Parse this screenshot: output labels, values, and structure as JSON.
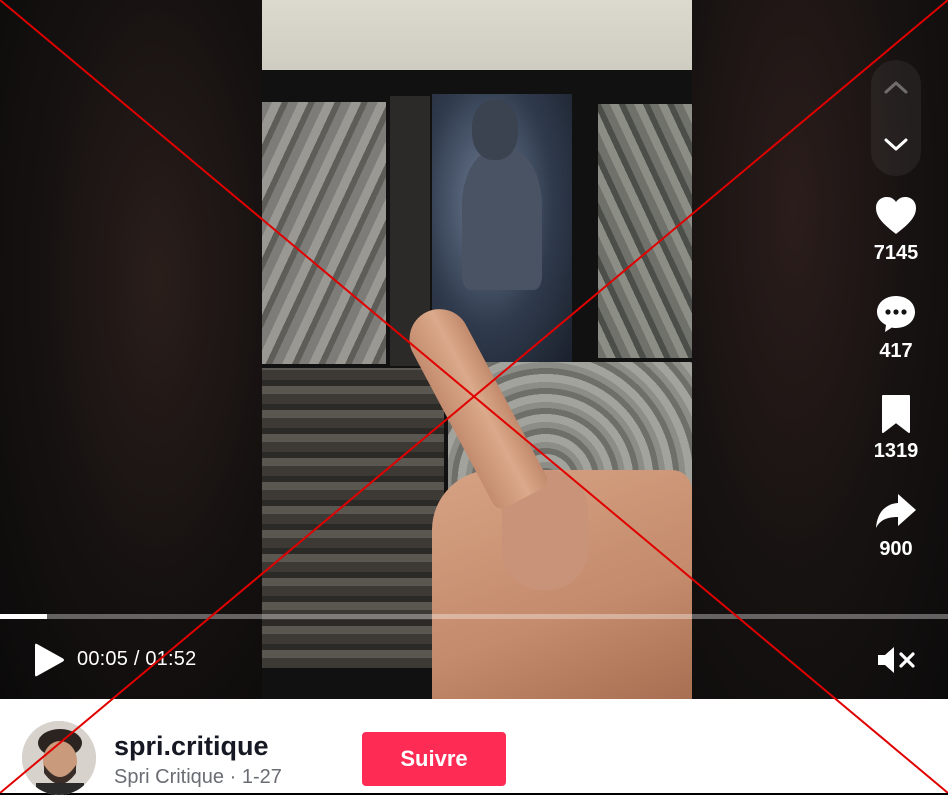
{
  "player": {
    "current_time": "00:05",
    "time_separator": " / ",
    "duration": "01:52",
    "progress_fraction": 0.05
  },
  "actions": {
    "likes": "7145",
    "comments": "417",
    "saves": "1319",
    "shares": "900"
  },
  "icons": {
    "nav_up": "chevron-up-icon",
    "nav_down": "chevron-down-icon",
    "like": "heart-icon",
    "comment": "comment-bubble-icon",
    "save": "bookmark-icon",
    "share": "share-arrow-icon",
    "play": "play-icon",
    "mute": "muted-speaker-icon"
  },
  "author": {
    "username": "spri.critique",
    "display_name": "Spri Critique",
    "separator": " · ",
    "date": "1-27",
    "follow_label": "Suivre"
  },
  "colors": {
    "accent": "#fe2c55",
    "cross_overlay": "#e00000"
  }
}
